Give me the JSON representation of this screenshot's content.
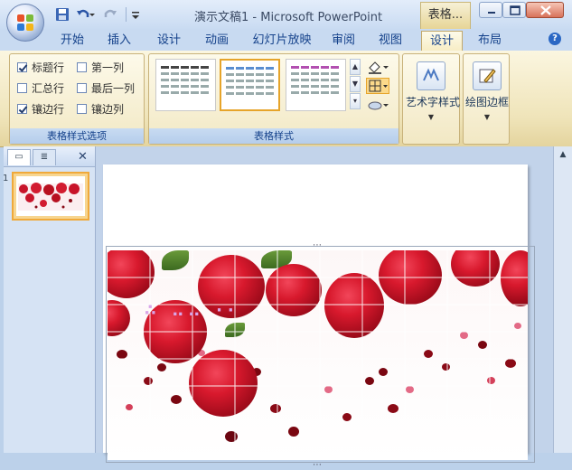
{
  "window": {
    "title": "演示文稿1 - Microsoft PowerPoint",
    "context_tab": "表格..."
  },
  "quick_access": {
    "icons": [
      "save-icon",
      "undo-icon",
      "redo-icon",
      "customize-icon"
    ]
  },
  "tabs": [
    {
      "label": "开始",
      "active": false
    },
    {
      "label": "插入",
      "active": false
    },
    {
      "label": "设计",
      "active": false
    },
    {
      "label": "动画",
      "active": false
    },
    {
      "label": "幻灯片放映",
      "active": false
    },
    {
      "label": "审阅",
      "active": false
    },
    {
      "label": "视图",
      "active": false
    },
    {
      "label": "设计",
      "active": true
    },
    {
      "label": "布局",
      "active": false
    }
  ],
  "ribbon": {
    "style_options": {
      "group_label": "表格样式选项",
      "checkboxes": [
        {
          "label": "标题行",
          "checked": true
        },
        {
          "label": "第一列",
          "checked": false
        },
        {
          "label": "汇总行",
          "checked": false
        },
        {
          "label": "最后一列",
          "checked": false
        },
        {
          "label": "镶边行",
          "checked": true
        },
        {
          "label": "镶边列",
          "checked": false
        }
      ]
    },
    "table_styles": {
      "group_label": "表格样式"
    },
    "wordart": {
      "label": "艺术字样式"
    },
    "borders": {
      "label": "绘图边框"
    }
  },
  "slides_pane": {
    "slide_number": "1"
  },
  "slide": {
    "bottom_text": "∴ ‥‥ ··"
  },
  "colors": {
    "accent": "#f0a93a",
    "ribbon_blue": "#c8daf1",
    "rose_red": "#d8192d"
  }
}
